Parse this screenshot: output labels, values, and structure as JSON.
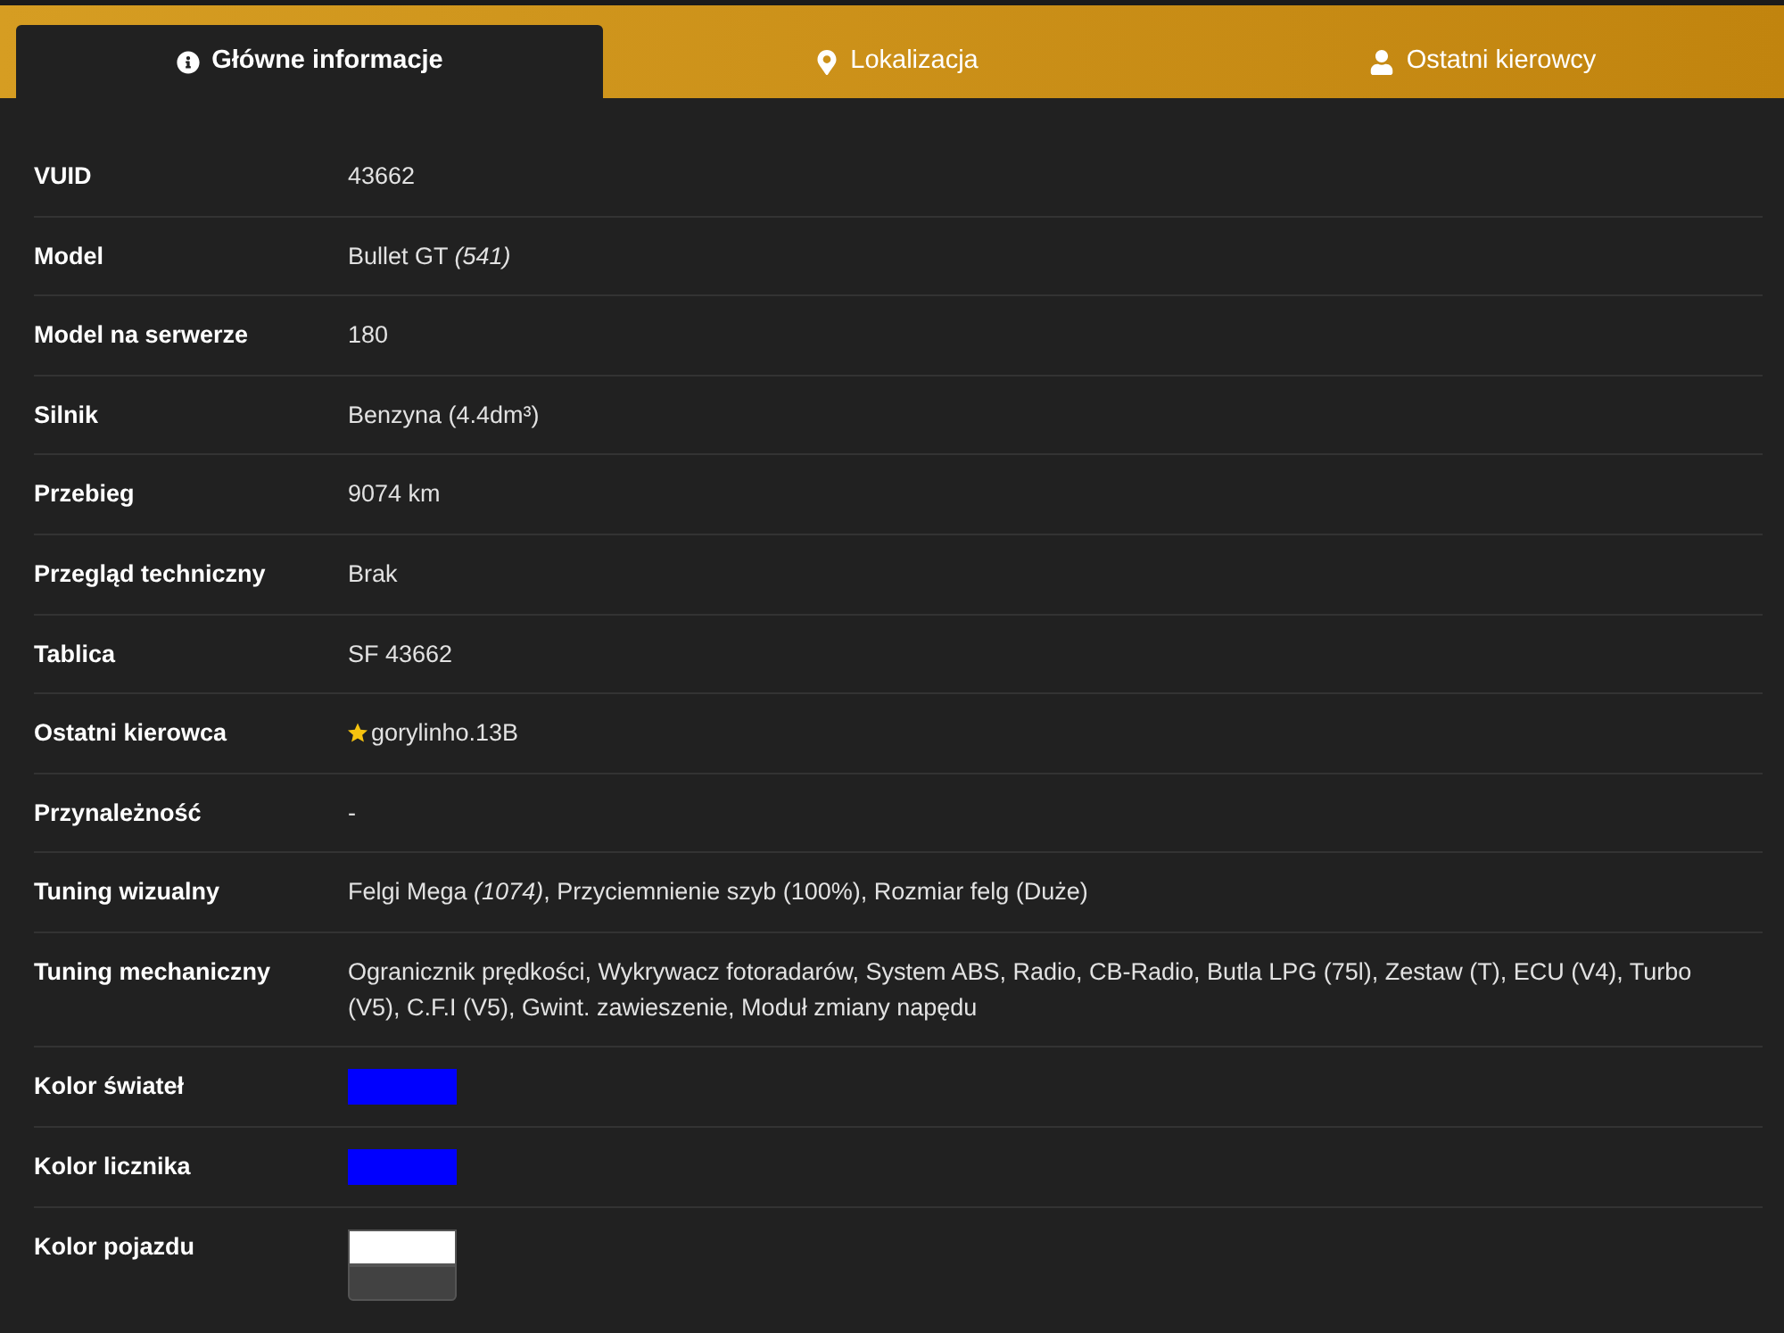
{
  "tabs": [
    {
      "label": "Główne informacje",
      "selected": true
    },
    {
      "label": "Lokalizacja",
      "selected": false
    },
    {
      "label": "Ostatni kierowcy",
      "selected": false
    }
  ],
  "rows": [
    {
      "kind": "text",
      "label": "VUID",
      "value": "43662"
    },
    {
      "kind": "text",
      "label": "Model",
      "value": "Bullet GT *(541)*"
    },
    {
      "kind": "text",
      "label": "Model na serwerze",
      "value": "180"
    },
    {
      "kind": "text",
      "label": "Silnik",
      "value": "Benzyna (4.4dm³)"
    },
    {
      "kind": "text",
      "label": "Przebieg",
      "value": "9074 km"
    },
    {
      "kind": "text",
      "label": "Przegląd techniczny",
      "value": "Brak"
    },
    {
      "kind": "text",
      "label": "Tablica",
      "value": "SF 43662"
    },
    {
      "kind": "driver",
      "label": "Ostatni kierowca",
      "value": "gorylinho.13B"
    },
    {
      "kind": "text",
      "label": "Przynależność",
      "value": "-"
    },
    {
      "kind": "text",
      "label": "Tuning wizualny",
      "value": "Felgi Mega *(1074)*, Przyciemnienie szyb (100%), Rozmiar felg (Duże)"
    },
    {
      "kind": "text",
      "label": "Tuning mechaniczny",
      "value": "Ogranicznik prędkości, Wykrywacz fotoradarów, System ABS, Radio, CB-Radio, Butla LPG (75l), Zestaw (T), ECU (V4), Turbo (V5), C.F.I (V5), Gwint. zawieszenie, Moduł zmiany napędu"
    },
    {
      "kind": "color",
      "label": "Kolor świateł",
      "swatches": [
        {
          "color": "#0000ff"
        }
      ]
    },
    {
      "kind": "color",
      "label": "Kolor licznika",
      "swatches": [
        {
          "color": "#0000ff"
        }
      ]
    },
    {
      "kind": "color",
      "label": "Kolor pojazdu",
      "swatches": [
        {
          "color": "#ffffff"
        },
        {
          "color": "#424242"
        }
      ]
    }
  ]
}
